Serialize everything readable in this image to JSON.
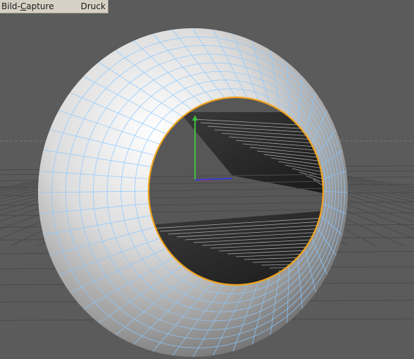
{
  "menubar": {
    "items": [
      {
        "label_before": "Bild-",
        "label_mnemonic": "C",
        "label_after": "apture"
      },
      {
        "label": "Druck"
      }
    ]
  },
  "viewport": {
    "object": "torus",
    "mesh_color": "#8cc8ff",
    "selection_edge_color": "#f0a31c",
    "background": "#5b5b5b",
    "axis_colors": {
      "x": "#d23a3a",
      "y": "#3fbf3f",
      "z": "#3a3ad2"
    }
  }
}
